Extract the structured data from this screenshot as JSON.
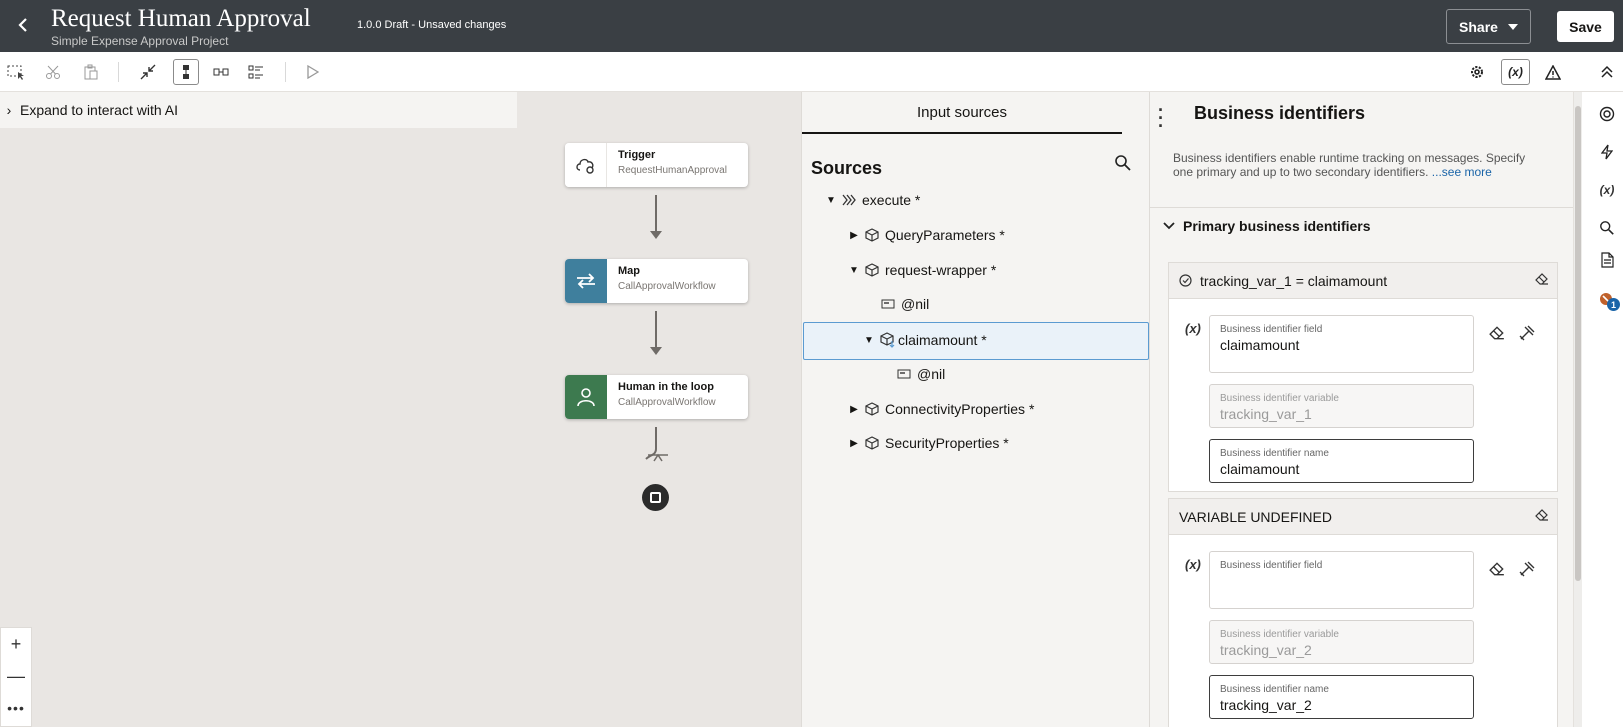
{
  "header": {
    "title": "Request Human Approval",
    "subtitle": "Simple Expense Approval Project",
    "version": "1.0.0 Draft - Unsaved changes",
    "share_label": "Share",
    "save_label": "Save"
  },
  "ai_bar": {
    "label": "Expand to interact with AI"
  },
  "flow": {
    "nodes": [
      {
        "name": "Trigger",
        "sub": "RequestHumanApproval",
        "color": "#ffffff",
        "icon": "cloud-gear-icon"
      },
      {
        "name": "Map",
        "sub": "CallApprovalWorkflow",
        "color": "#3f7f9d",
        "icon": "swap-arrows-icon"
      },
      {
        "name": "Human in the loop",
        "sub": "CallApprovalWorkflow",
        "color": "#3d7a4f",
        "icon": "person-icon"
      }
    ]
  },
  "sources": {
    "tab": "Input sources",
    "title": "Sources",
    "items": [
      "execute *",
      "QueryParameters *",
      "request-wrapper *",
      "@nil",
      "claimamount *",
      "@nil",
      "ConnectivityProperties *",
      "SecurityProperties *"
    ]
  },
  "business": {
    "title": "Business identifiers",
    "desc": "Business identifiers enable runtime tracking on messages. Specify one primary and up to two secondary identifiers.",
    "see_more": " ...see more",
    "primary_heading": "Primary business identifiers",
    "cards": [
      {
        "header": "tracking_var_1 = claimamount",
        "field_label": "Business identifier field",
        "field_value": "claimamount",
        "var_label": "Business identifier variable",
        "var_value": "tracking_var_1",
        "name_label": "Business identifier name",
        "name_value": "claimamount"
      },
      {
        "header": "VARIABLE UNDEFINED",
        "field_label": "Business identifier field",
        "field_value": "",
        "var_label": "Business identifier variable",
        "var_value": "tracking_var_2",
        "name_label": "Business identifier name",
        "name_value": "tracking_var_2"
      }
    ]
  },
  "rail": {
    "badge": "1"
  }
}
